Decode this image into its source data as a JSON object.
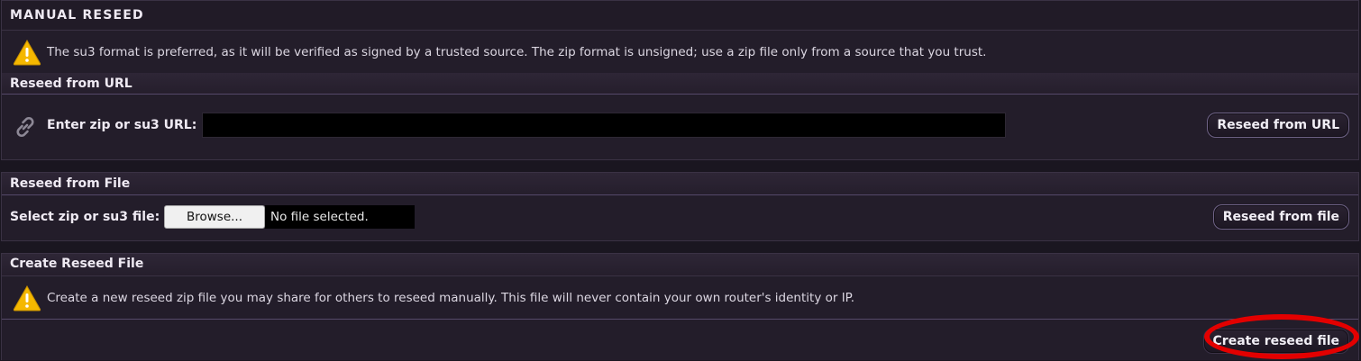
{
  "title": "MANUAL RESEED",
  "notice": {
    "icon": "warning-icon",
    "text": "The su3 format is preferred, as it will be verified as signed by a trusted source.  The zip format is unsigned; use a zip file only from a source that you trust."
  },
  "url_section": {
    "heading": "Reseed from URL",
    "icon": "link-icon",
    "label": "Enter zip or su3 URL:",
    "input_value": "",
    "button": "Reseed from URL"
  },
  "file_section": {
    "heading": "Reseed from File",
    "label": "Select zip or su3 file:",
    "browse_button": "Browse...",
    "file_status": "No file selected.",
    "button": "Reseed from file"
  },
  "create_section": {
    "heading": "Create Reseed File",
    "icon": "warning-icon",
    "text": "Create a new reseed zip file you may share for others to reseed manually.  This file will never contain your own router's identity or IP.",
    "button": "Create reseed file"
  },
  "colors": {
    "background": "#231d2a",
    "accent_border": "#6f6387",
    "warning": "#f5b800",
    "highlight": "#e30000"
  }
}
